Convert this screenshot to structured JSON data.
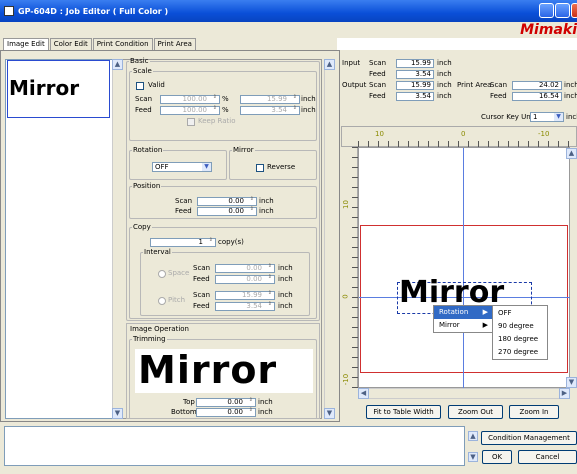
{
  "window": {
    "title": "GP-604D : Job Editor ( Full Color )"
  },
  "brand": {
    "logo": "Mimaki"
  },
  "tabs": [
    "Image Edit",
    "Color Edit",
    "Print Condition",
    "Print Area"
  ],
  "thumbnail": {
    "text": "Mirror"
  },
  "basic": {
    "legend": "Basic",
    "scale": {
      "legend": "Scale",
      "valid_label": "Valid",
      "scan_label": "Scan",
      "feed_label": "Feed",
      "scan_pct": "100.00",
      "feed_pct": "100.00",
      "pct_unit": "%",
      "scan_inch": "15.99",
      "feed_inch": "3.54",
      "unit": "inch",
      "keep_ratio": "Keep Ratio"
    },
    "rotation": {
      "legend": "Rotation",
      "value": "OFF"
    },
    "mirror": {
      "legend": "Mirror",
      "reverse_label": "Reverse"
    },
    "position": {
      "legend": "Position",
      "scan_label": "Scan",
      "feed_label": "Feed",
      "scan": "0.00",
      "feed": "0.00",
      "unit": "inch"
    },
    "copy": {
      "legend": "Copy",
      "count": "1",
      "unit": "copy(s)",
      "interval": {
        "legend": "Interval",
        "space_label": "Space",
        "pitch_label": "Pitch",
        "scan_label": "Scan",
        "feed_label": "Feed",
        "space_scan": "0.00",
        "space_feed": "0.00",
        "pitch_scan": "15.99",
        "pitch_feed": "3.54",
        "unit": "inch"
      }
    }
  },
  "image_operation": {
    "title": "Image Operation",
    "trimming": {
      "legend": "Trimming",
      "preview": "Mirror",
      "top_label": "Top",
      "bottom_label": "Bottom",
      "top": "0.00",
      "bottom": "0.00",
      "unit": "inch"
    }
  },
  "info": {
    "input_label": "Input",
    "output_label": "Output",
    "scan_label": "Scan",
    "feed_label": "Feed",
    "unit": "inch",
    "input_scan": "15.99",
    "input_feed": "3.54",
    "output_scan": "15.99",
    "output_feed": "3.54",
    "print_area_label": "Print Area",
    "print_area_scan": "24.02",
    "print_area_feed": "16.54",
    "cursor_key_label": "Cursor Key Unit",
    "cursor_key_value": "1",
    "cursor_key_unit": "inch"
  },
  "ruler": {
    "h_ticks": [
      "10",
      "0",
      "-10"
    ],
    "v_ticks": [
      "10",
      "0",
      "-10"
    ]
  },
  "canvas": {
    "image_text": "Mirror"
  },
  "context_menu": {
    "items": [
      {
        "label": "Rotation",
        "arrow": "▶"
      },
      {
        "label": "Mirror",
        "arrow": "▶"
      }
    ],
    "submenu": [
      "OFF",
      "90 degree",
      "180 degree",
      "270 degree"
    ]
  },
  "canvas_buttons": {
    "fit": "Fit to Table Width",
    "zoom_out": "Zoom Out",
    "zoom_in": "Zoom In"
  },
  "bottom": {
    "condition_management": "Condition Management",
    "ok": "OK",
    "cancel": "Cancel"
  },
  "colors": {
    "accent": "#0a4fd8",
    "brand": "#d00000",
    "selection": "#316ac5"
  }
}
